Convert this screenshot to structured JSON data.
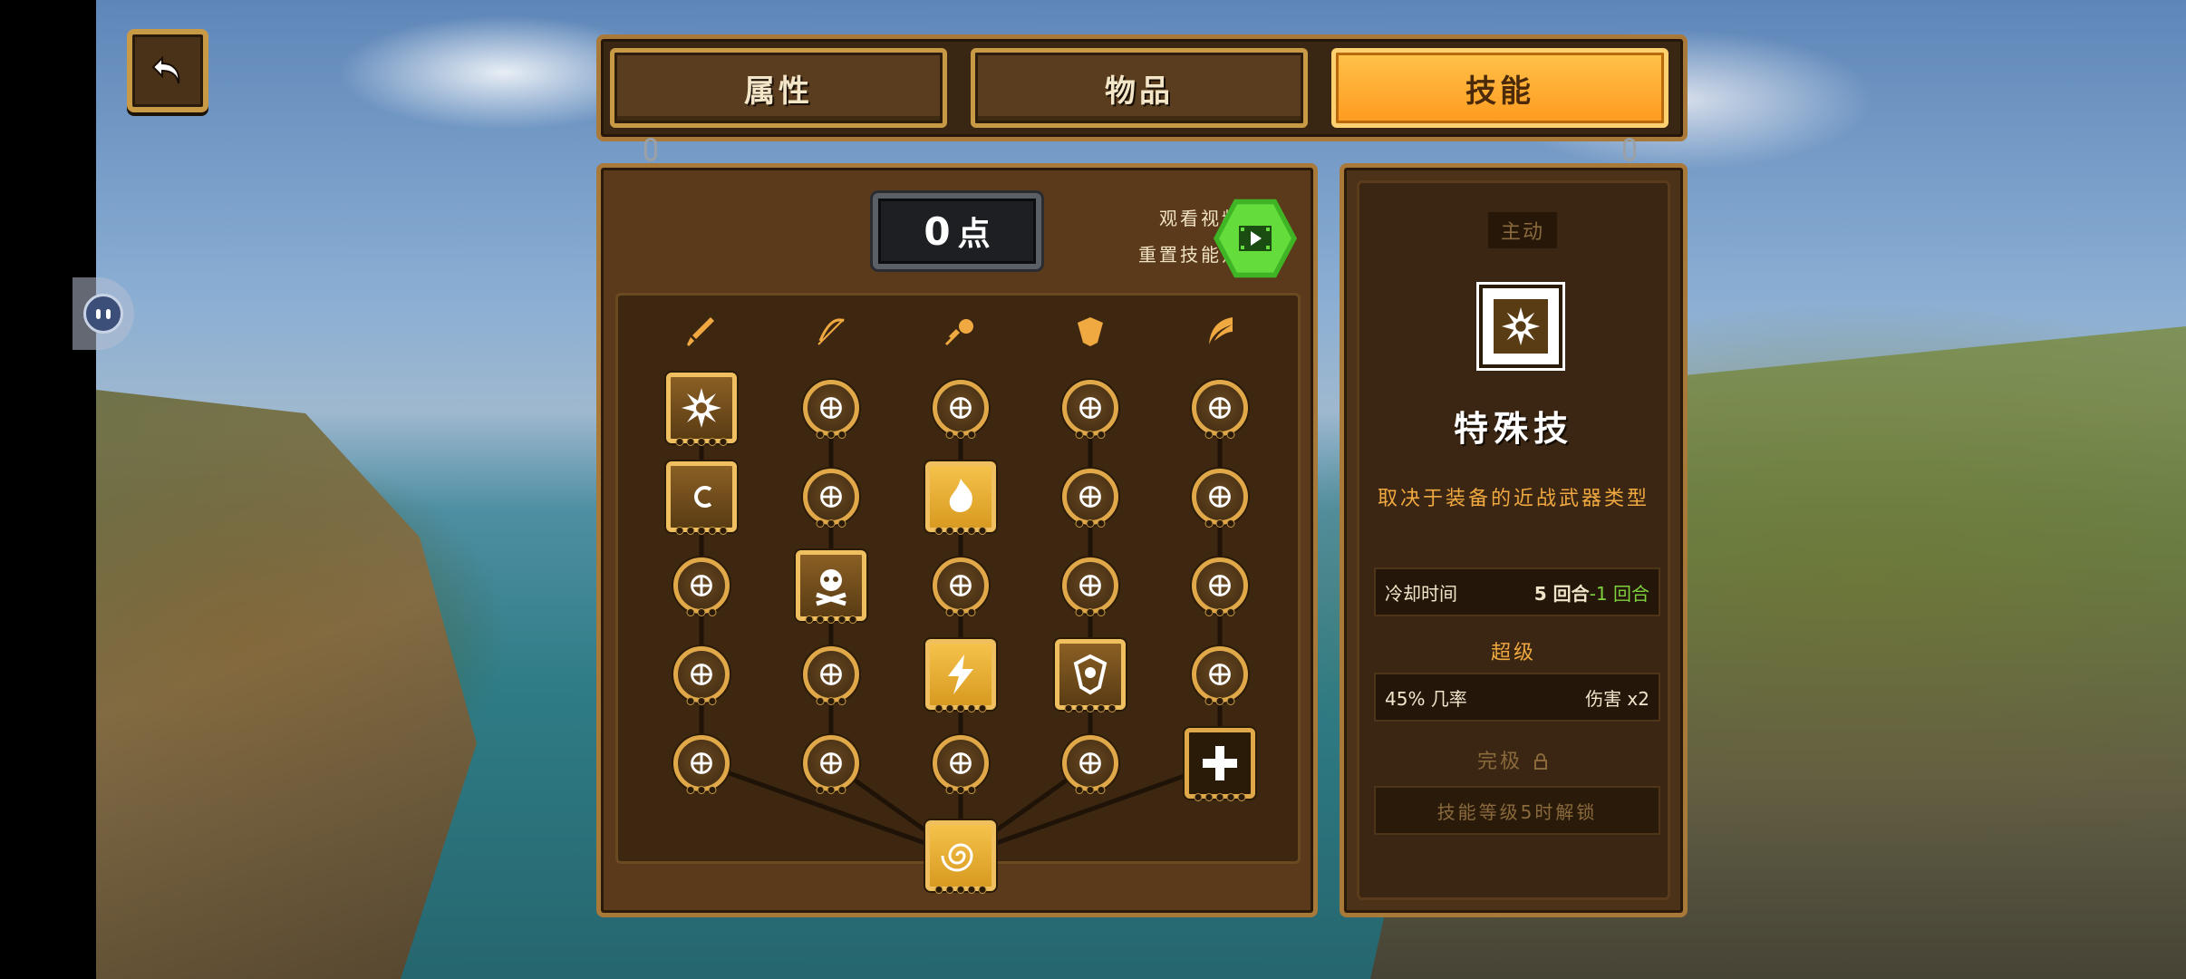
{
  "tabs": [
    {
      "label": "属性",
      "active": false
    },
    {
      "label": "物品",
      "active": false
    },
    {
      "label": "技能",
      "active": true
    }
  ],
  "points": {
    "value": "0",
    "unit": "点"
  },
  "reset": {
    "line1": "观看视频",
    "line2": "重置技能点",
    "icon": "video-play-icon"
  },
  "categories": [
    "sword-icon",
    "bow-icon",
    "magic-orb-icon",
    "shield-icon",
    "feather-wing-icon"
  ],
  "skill_grid": [
    [
      "burst-icon",
      "bow-target-icon",
      "sun-burst-icon",
      "broken-heart-icon",
      "spiral-arrow-icon"
    ],
    [
      "hook-icon",
      "bow-drop-icon",
      "flame-icon",
      "sword-shield-icon",
      "helmet-arrow-icon"
    ],
    [
      "coins-icon",
      "skull-crossbones-icon",
      "crosshair-icon",
      "armor-break-icon",
      "crossed-arrows-icon"
    ],
    [
      "magic-wand-icon",
      "crossbow-icon",
      "lightning-icon",
      "shield-emblem-icon",
      "helmet-icon"
    ],
    [
      "fist-icon",
      "arrow-strike-icon",
      "rotate-hand-icon",
      "triple-ring-icon",
      "plus-cross-icon"
    ]
  ],
  "root_skill": "vortex-icon",
  "detail": {
    "badge": "主动",
    "icon": "burst-icon",
    "name": "特殊技",
    "description": "取决于装备的近战武器类型",
    "cooldown_label": "冷却时间",
    "cooldown_value": "5 回合",
    "cooldown_reduction": "-1 回合",
    "super_title": "超级",
    "super_chance": "45% 几率",
    "super_effect": "伤害 x2",
    "ultimate_title": "完极",
    "ultimate_lock_text": "技能等级5时解锁"
  },
  "colors": {
    "active_tab": "#ff9a1f",
    "panel_border": "#a9793a",
    "accent_text": "#f0a840",
    "green_text": "#7ed23e"
  }
}
